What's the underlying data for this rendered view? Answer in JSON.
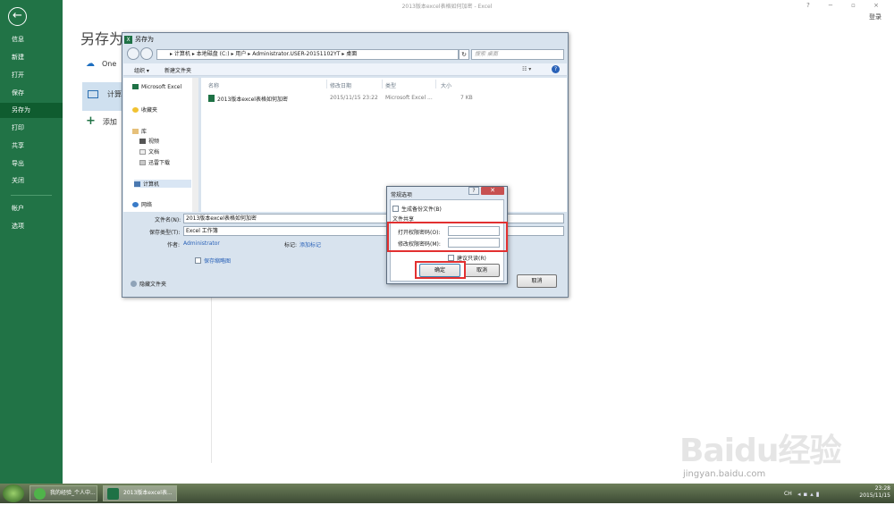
{
  "app": {
    "title": "2013版本excel表格如何加密 - Excel",
    "window_controls": "? − ▫ ×",
    "login": "登录"
  },
  "backstage": {
    "back_glyph": "←",
    "sidebar": [
      "信息",
      "新建",
      "打开",
      "保存",
      "另存为",
      "打印",
      "共享",
      "导出",
      "关闭",
      "帐户",
      "选项"
    ],
    "selected": "另存为",
    "page_title": "另存为",
    "places": {
      "onedrive": "One",
      "computer": "计算",
      "add": "添加"
    }
  },
  "save_dialog": {
    "title": "另存为",
    "breadcrumb": "▸  计算机  ▸  本地磁盘 (C:)  ▸  用户  ▸  Administrator.USER-20151102YT  ▸  桌面",
    "search_placeholder": "搜索 桌面",
    "toolbar": {
      "organize": "组织 ▾",
      "new_folder": "新建文件夹",
      "view": "☷ ▾",
      "help": "?"
    },
    "nav": [
      "Microsoft Excel",
      "收藏夹",
      "库",
      "视频",
      "文档",
      "迅雷下载",
      "计算机",
      "网络"
    ],
    "columns": [
      "名称",
      "修改日期",
      "类型",
      "大小"
    ],
    "files": [
      {
        "name": "2013版本excel表格如何加密",
        "modified": "2015/11/15 23:22",
        "type": "Microsoft Excel ...",
        "size": "7 KB"
      }
    ],
    "filename_label": "文件名(N):",
    "filename": "2013版本excel表格如何加密",
    "filetype_label": "保存类型(T):",
    "filetype": "Excel 工作簿",
    "author_label": "作者:",
    "author": "Administrator",
    "tags_label": "标记:",
    "tags_link": "添加标记",
    "thumbnail": "保存缩略图",
    "hide_folders": "隐藏文件夹",
    "cancel": "取消"
  },
  "options_dialog": {
    "title": "常规选项",
    "backup": "生成备份文件(B)",
    "section": "文件共享",
    "open_pwd_label": "打开权限密码(O):",
    "modify_pwd_label": "修改权限密码(M):",
    "readonly": "建议只读(R)",
    "ok": "确定",
    "cancel": "取消"
  },
  "taskbar": {
    "tasks": [
      "我的经验_个人中...",
      "2013版本excel表..."
    ],
    "lang": "CH",
    "time": "23:28",
    "date": "2015/11/15"
  },
  "watermark": {
    "text": "Baidu经验",
    "url": "jingyan.baidu.com"
  },
  "colors": {
    "excel_green": "#217346",
    "highlight_red": "#e23030",
    "dialog_bg": "#d8e3ee"
  }
}
